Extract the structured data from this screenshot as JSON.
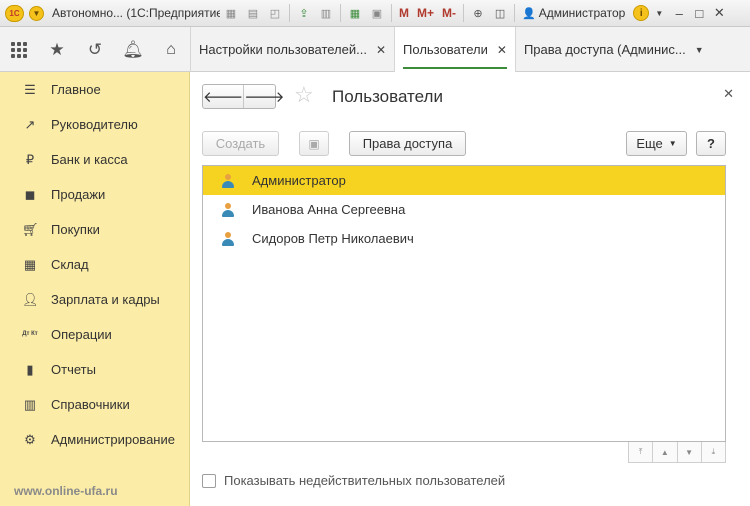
{
  "titlebar": {
    "logo_text": "1С",
    "title": "Автономно... (1С:Предприятие)",
    "memory_buttons": [
      "M",
      "M+",
      "M-"
    ],
    "user": "Администратор"
  },
  "tabs": [
    {
      "label": "Настройки пользователей...",
      "active": false
    },
    {
      "label": "Пользователи",
      "active": true
    },
    {
      "label": "Права доступа (Админис...",
      "active": false
    }
  ],
  "sidebar": {
    "items": [
      {
        "label": "Главное",
        "icon": "menu-lines-icon"
      },
      {
        "label": "Руководителю",
        "icon": "trend-up-icon"
      },
      {
        "label": "Банк и касса",
        "icon": "ruble-coin-icon"
      },
      {
        "label": "Продажи",
        "icon": "shopping-bag-icon"
      },
      {
        "label": "Покупки",
        "icon": "cart-icon"
      },
      {
        "label": "Склад",
        "icon": "warehouse-grid-icon"
      },
      {
        "label": "Зарплата и кадры",
        "icon": "person-icon"
      },
      {
        "label": "Операции",
        "icon": "debit-credit-icon"
      },
      {
        "label": "Отчеты",
        "icon": "bar-chart-icon"
      },
      {
        "label": "Справочники",
        "icon": "books-icon"
      },
      {
        "label": "Администрирование",
        "icon": "gear-icon"
      }
    ],
    "dtkt_glyph": "Дт Кт"
  },
  "watermark": "www.online-ufa.ru",
  "form": {
    "title": "Пользователи",
    "create_label": "Создать",
    "access_rights_label": "Права доступа",
    "more_label": "Еще",
    "help_label": "?",
    "users": [
      {
        "name": "Администратор",
        "selected": true
      },
      {
        "name": "Иванова Анна Сергеевна",
        "selected": false
      },
      {
        "name": "Сидоров Петр Николаевич",
        "selected": false
      }
    ],
    "show_invalid_label": "Показывать недействительных пользователей"
  },
  "colors": {
    "sidebar_bg": "#fbeca7",
    "selection": "#f6d321",
    "active_tab_underline": "#3c8c3c"
  }
}
